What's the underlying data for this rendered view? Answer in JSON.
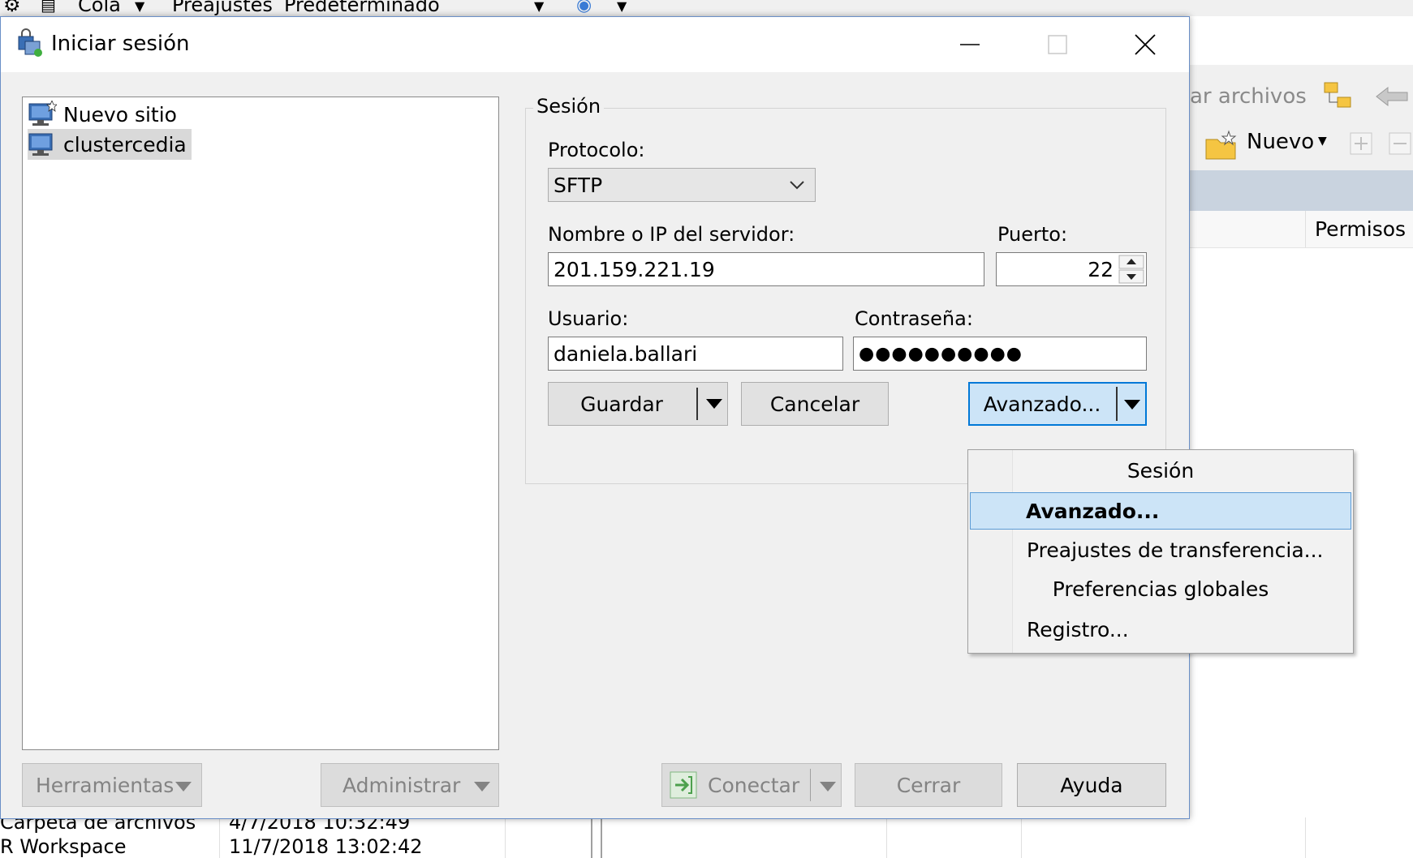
{
  "background": {
    "toolbar": {
      "queue_label": "Cola",
      "presets_label": "Preajustes",
      "presets_value": "Predeterminado"
    },
    "right_panel": {
      "toolbar_text": "ar archivos",
      "new_button": "Nuevo",
      "column_header": "Permisos"
    },
    "bottom_rows": [
      {
        "name": "Carpeta de archivos",
        "date": "4/7/2018  10:32:49"
      },
      {
        "name": "R Workspace",
        "date": "11/7/2018  13:02:42"
      }
    ]
  },
  "dialog": {
    "title": "Iniciar sesión",
    "sites": [
      {
        "label": "Nuevo sitio"
      },
      {
        "label": "clustercedia"
      }
    ],
    "session": {
      "legend": "Sesión",
      "protocol_label": "Protocolo:",
      "protocol_value": "SFTP",
      "host_label": "Nombre o IP del servidor:",
      "host_value": "201.159.221.19",
      "port_label": "Puerto:",
      "port_value": "22",
      "user_label": "Usuario:",
      "user_value": "daniela.ballari",
      "password_label": "Contraseña:",
      "password_value": "●●●●●●●●●●"
    },
    "buttons": {
      "save": "Guardar",
      "cancel": "Cancelar",
      "advanced": "Avanzado...",
      "tools": "Herramientas",
      "manage": "Administrar",
      "connect": "Conectar",
      "close": "Cerrar",
      "help": "Ayuda"
    },
    "advanced_menu": {
      "items": [
        {
          "label": "Sesión"
        },
        {
          "label": "Avanzado..."
        },
        {
          "label": "Preajustes de transferencia..."
        },
        {
          "label": "Preferencias globales"
        },
        {
          "label": "Registro..."
        }
      ],
      "highlighted_item": "Avanzado..."
    }
  },
  "colors": {
    "accent": "#5b9bd5",
    "highlight": "#cce4f7",
    "dialog_border": "#6a8fc7"
  }
}
